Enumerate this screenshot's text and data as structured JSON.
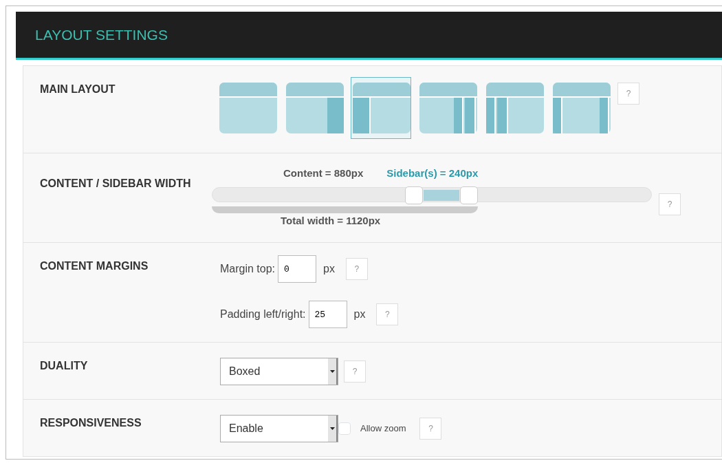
{
  "header": {
    "title": "LAYOUT SETTINGS"
  },
  "main_layout": {
    "label": "MAIN LAYOUT",
    "help": "?",
    "options": [
      {
        "kind": "full",
        "selected": false
      },
      {
        "kind": "right",
        "selected": false
      },
      {
        "kind": "left",
        "selected": true
      },
      {
        "kind": "two-right",
        "selected": false
      },
      {
        "kind": "two-left",
        "selected": false
      },
      {
        "kind": "both",
        "selected": false
      }
    ]
  },
  "width": {
    "label": "CONTENT / SIDEBAR WIDTH",
    "content_text": "Content = 880px",
    "sidebar_text": "Sidebar(s) = 240px",
    "total_text": "Total width = 1120px",
    "help": "?",
    "handles": [
      {
        "level": 0.46
      },
      {
        "level": 0.585
      }
    ]
  },
  "margins": {
    "label": "CONTENT MARGINS",
    "fields": [
      {
        "label": "Margin top:",
        "value": "0",
        "unit": "px",
        "help": "?"
      },
      {
        "label": "Padding left/right:",
        "value": "25",
        "unit": "px",
        "help": "?"
      }
    ]
  },
  "duality": {
    "label": "DUALITY",
    "value": "Boxed",
    "help": "?"
  },
  "responsiveness": {
    "label": "RESPONSIVENESS",
    "value": "Enable",
    "checkbox": {
      "label": "Allow zoom",
      "checked": false
    },
    "help": "?"
  }
}
